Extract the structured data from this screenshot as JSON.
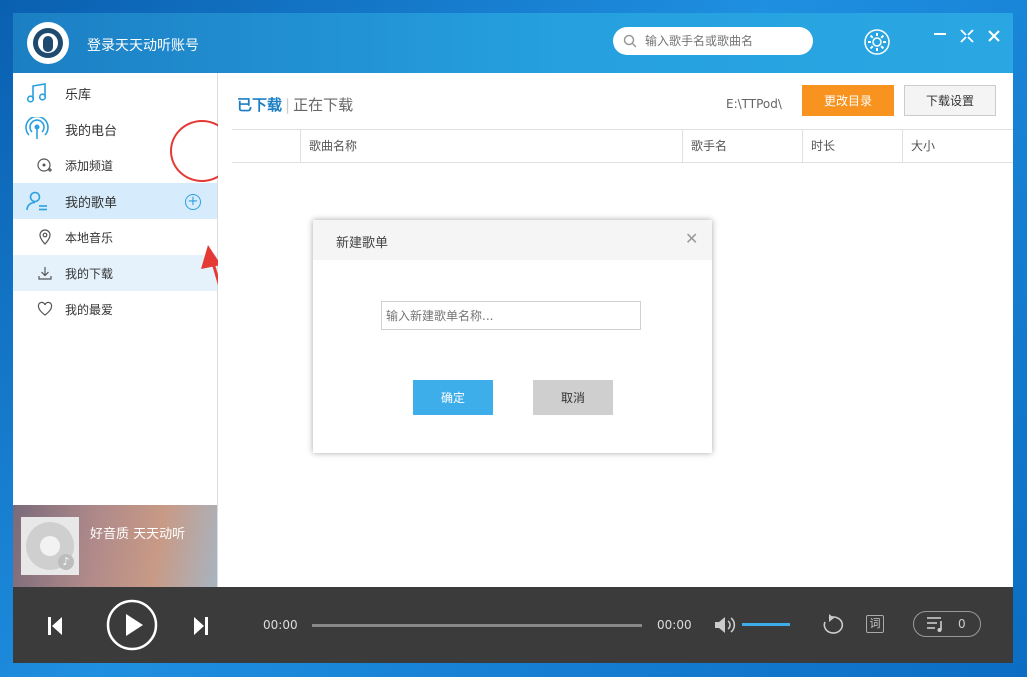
{
  "titlebar": {
    "login_text": "登录天天动听账号",
    "search_placeholder": "输入歌手名或歌曲名"
  },
  "sidebar": {
    "items": [
      {
        "label": "乐库",
        "icon": "music-note-icon"
      },
      {
        "label": "我的电台",
        "icon": "radio-icon"
      },
      {
        "label": "添加频道",
        "icon": "add-channel-icon"
      },
      {
        "label": "我的歌单",
        "icon": "user-playlist-icon"
      },
      {
        "label": "本地音乐",
        "icon": "location-pin-icon"
      },
      {
        "label": "我的下载",
        "icon": "download-icon"
      },
      {
        "label": "我的最爱",
        "icon": "heart-icon"
      }
    ],
    "promo_text": "好音质 天天动听"
  },
  "main": {
    "tab_downloaded": "已下载",
    "tab_downloading": "正在下载",
    "path": "E:\\TTPod\\",
    "change_dir_label": "更改目录",
    "download_settings_label": "下载设置",
    "columns": [
      "歌曲名称",
      "歌手名",
      "时长",
      "大小"
    ]
  },
  "dialog": {
    "title": "新建歌单",
    "input_placeholder": "输入新建歌单名称...",
    "ok_label": "确定",
    "cancel_label": "取消"
  },
  "player": {
    "current_time": "00:00",
    "total_time": "00:00",
    "lyric_label": "词",
    "queue_count": "0",
    "progress": 0,
    "volume": 1.0
  },
  "colors": {
    "accent": "#2aa0e0",
    "orange": "#f7931e",
    "annotation_red": "#e53935"
  }
}
